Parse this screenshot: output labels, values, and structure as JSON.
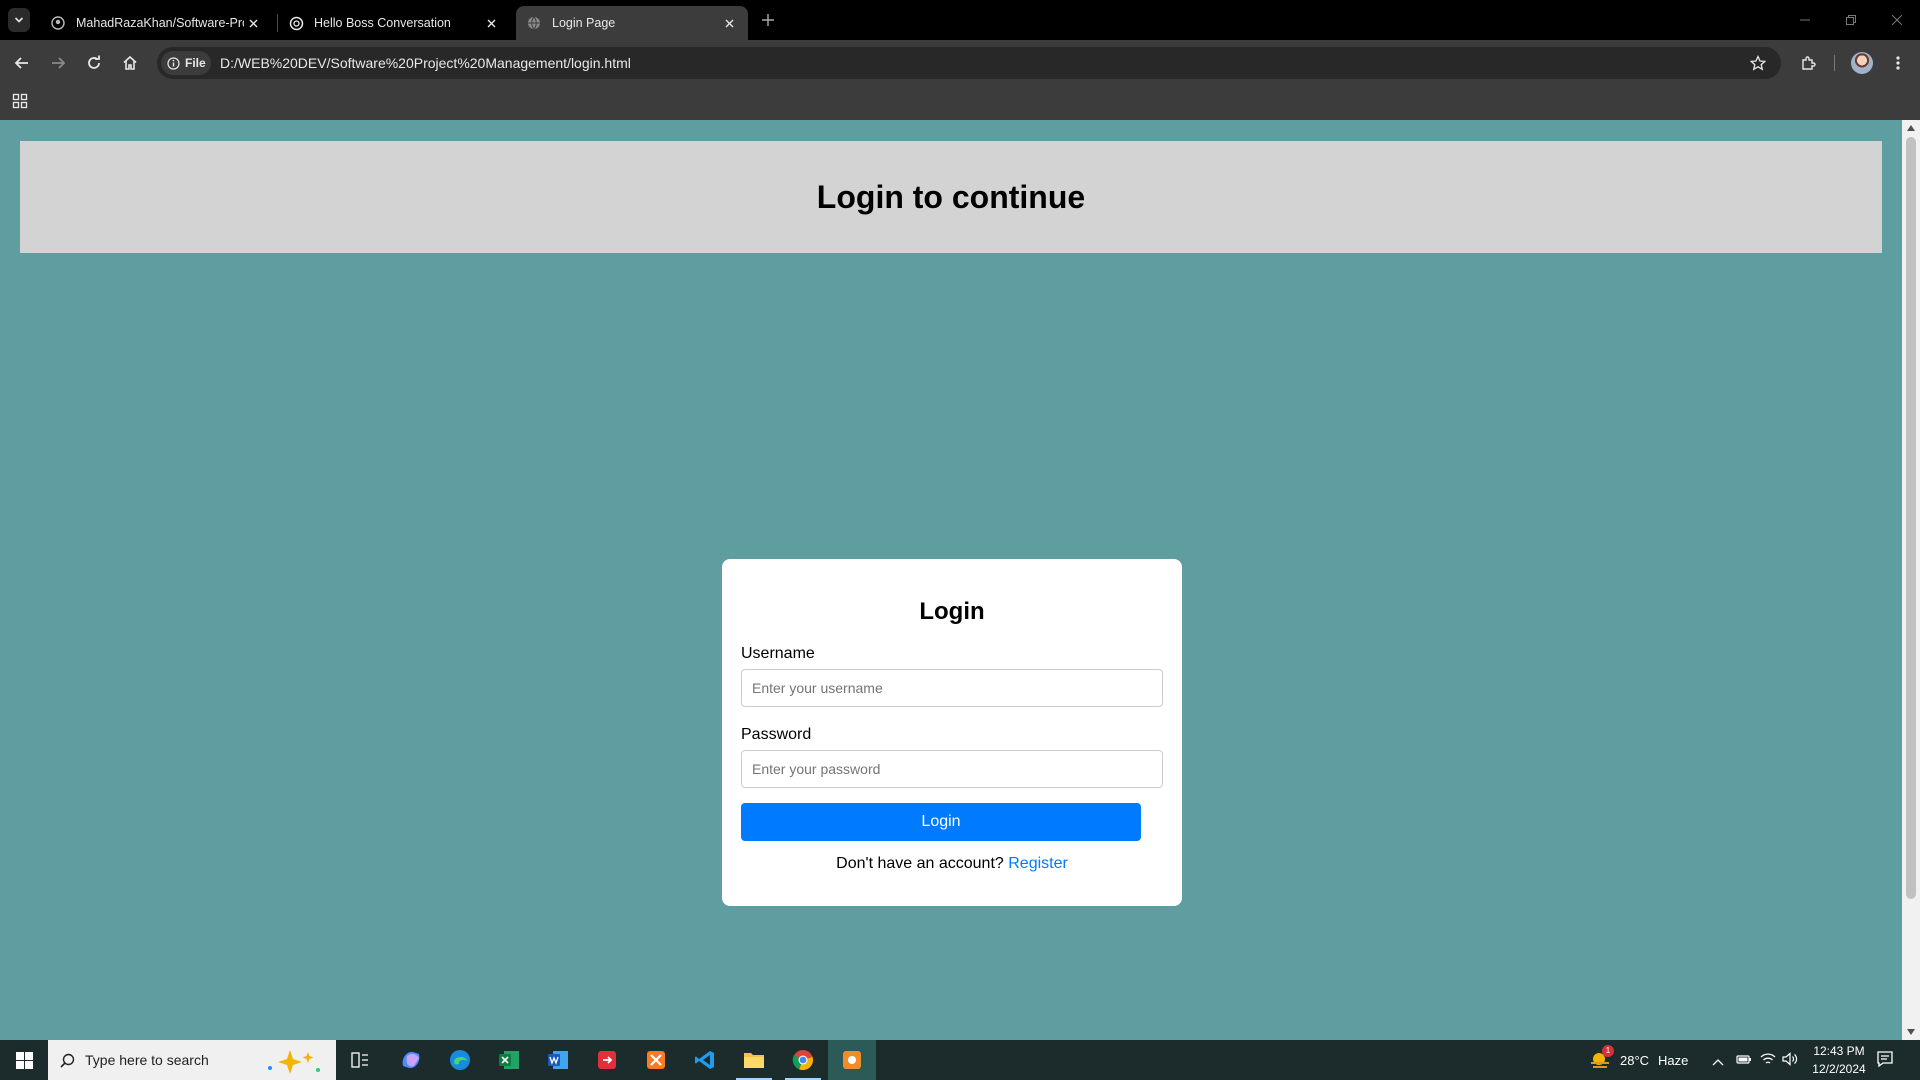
{
  "browser": {
    "tabs": [
      {
        "title": "MahadRazaKhan/Software-Proj",
        "favicon": "github-icon"
      },
      {
        "title": "Hello Boss Conversation",
        "favicon": "chatgpt-icon"
      },
      {
        "title": "Login Page",
        "favicon": "globe-icon",
        "active": true
      }
    ],
    "address_chip": "File",
    "url": "D:/WEB%20DEV/Software%20Project%20Management/login.html"
  },
  "page": {
    "header_title": "Login to continue",
    "background_color": "#5f9ea0",
    "header_color": "#d3d3d3",
    "accent_color": "#007bff"
  },
  "login_form": {
    "title": "Login",
    "username_label": "Username",
    "username_placeholder": "Enter your username",
    "username_value": "",
    "password_label": "Password",
    "password_placeholder": "Enter your password",
    "password_value": "",
    "submit_label": "Login",
    "register_prompt": "Don't have an account?",
    "register_link": "Register"
  },
  "taskbar": {
    "search_placeholder": "Type here to search",
    "apps": [
      "task-view-icon",
      "copilot-icon",
      "edge-icon",
      "excel-icon",
      "word-icon",
      "git-icon",
      "xampp-icon",
      "vscode-icon",
      "file-explorer-icon",
      "chrome-icon",
      "app-icon"
    ],
    "weather_temp": "28°C",
    "weather_text": "Haze",
    "weather_badge": "1",
    "time": "12:43 PM",
    "date": "12/2/2024"
  }
}
